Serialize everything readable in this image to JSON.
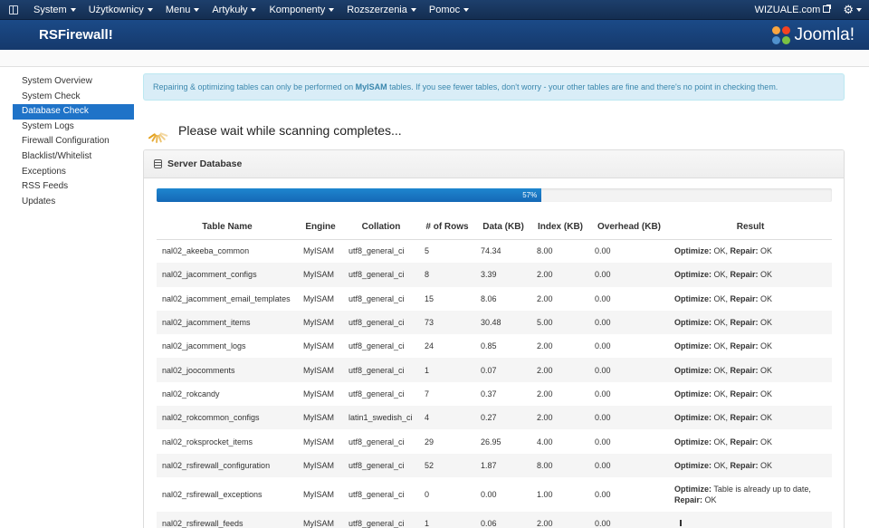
{
  "topbar": {
    "menu": [
      "System",
      "Użytkownicy",
      "Menu",
      "Artykuły",
      "Komponenty",
      "Rozszerzenia",
      "Pomoc"
    ],
    "site_link": "WIZUALE.com"
  },
  "header": {
    "title": "RSFirewall!",
    "brand": "Joomla!"
  },
  "sidebar": {
    "items": [
      "System Overview",
      "System Check",
      "Database Check",
      "System Logs",
      "Firewall Configuration",
      "Blacklist/Whitelist",
      "Exceptions",
      "RSS Feeds",
      "Updates"
    ],
    "active_index": 2
  },
  "alert": {
    "before": "Repairing & optimizing tables can only be performed on ",
    "highlight": "MyISAM",
    "after": " tables. If you see fewer tables, don't worry - your other tables are fine and there's no point in checking them."
  },
  "scan": {
    "message": "Please wait while scanning completes..."
  },
  "panel": {
    "title": "Server Database"
  },
  "progress": {
    "percent": 57,
    "label": "57%"
  },
  "table": {
    "columns": [
      "Table Name",
      "Engine",
      "Collation",
      "# of Rows",
      "Data (KB)",
      "Index (KB)",
      "Overhead (KB)",
      "Result"
    ],
    "labels": {
      "optimize": "Optimize:",
      "repair": "Repair:"
    },
    "rows": [
      {
        "name": "nal02_akeeba_common",
        "engine": "MyISAM",
        "collation": "utf8_general_ci",
        "rows": "5",
        "data": "74.34",
        "index": "8.00",
        "overhead": "0.00",
        "optimize": " OK, ",
        "repair": " OK"
      },
      {
        "name": "nal02_jacomment_configs",
        "engine": "MyISAM",
        "collation": "utf8_general_ci",
        "rows": "8",
        "data": "3.39",
        "index": "2.00",
        "overhead": "0.00",
        "optimize": " OK, ",
        "repair": " OK"
      },
      {
        "name": "nal02_jacomment_email_templates",
        "engine": "MyISAM",
        "collation": "utf8_general_ci",
        "rows": "15",
        "data": "8.06",
        "index": "2.00",
        "overhead": "0.00",
        "optimize": " OK, ",
        "repair": " OK"
      },
      {
        "name": "nal02_jacomment_items",
        "engine": "MyISAM",
        "collation": "utf8_general_ci",
        "rows": "73",
        "data": "30.48",
        "index": "5.00",
        "overhead": "0.00",
        "optimize": " OK, ",
        "repair": " OK"
      },
      {
        "name": "nal02_jacomment_logs",
        "engine": "MyISAM",
        "collation": "utf8_general_ci",
        "rows": "24",
        "data": "0.85",
        "index": "2.00",
        "overhead": "0.00",
        "optimize": " OK, ",
        "repair": " OK"
      },
      {
        "name": "nal02_joocomments",
        "engine": "MyISAM",
        "collation": "utf8_general_ci",
        "rows": "1",
        "data": "0.07",
        "index": "2.00",
        "overhead": "0.00",
        "optimize": " OK, ",
        "repair": " OK"
      },
      {
        "name": "nal02_rokcandy",
        "engine": "MyISAM",
        "collation": "utf8_general_ci",
        "rows": "7",
        "data": "0.37",
        "index": "2.00",
        "overhead": "0.00",
        "optimize": " OK, ",
        "repair": " OK"
      },
      {
        "name": "nal02_rokcommon_configs",
        "engine": "MyISAM",
        "collation": "latin1_swedish_ci",
        "rows": "4",
        "data": "0.27",
        "index": "2.00",
        "overhead": "0.00",
        "optimize": " OK, ",
        "repair": " OK"
      },
      {
        "name": "nal02_roksprocket_items",
        "engine": "MyISAM",
        "collation": "utf8_general_ci",
        "rows": "29",
        "data": "26.95",
        "index": "4.00",
        "overhead": "0.00",
        "optimize": " OK, ",
        "repair": " OK"
      },
      {
        "name": "nal02_rsfirewall_configuration",
        "engine": "MyISAM",
        "collation": "utf8_general_ci",
        "rows": "52",
        "data": "1.87",
        "index": "8.00",
        "overhead": "0.00",
        "optimize": " OK, ",
        "repair": " OK"
      },
      {
        "name": "nal02_rsfirewall_exceptions",
        "engine": "MyISAM",
        "collation": "utf8_general_ci",
        "rows": "0",
        "data": "0.00",
        "index": "1.00",
        "overhead": "0.00",
        "optimize": " Table is already up to date, ",
        "repair": " OK"
      },
      {
        "name": "nal02_rsfirewall_feeds",
        "engine": "MyISAM",
        "collation": "utf8_general_ci",
        "rows": "1",
        "data": "0.06",
        "index": "2.00",
        "overhead": "0.00",
        "optimize": "",
        "repair": ""
      }
    ]
  },
  "colors": {
    "accent": "#1f73c8",
    "header": "#1b4a87",
    "topbar": "#17365d",
    "alert_bg": "#d9edf7"
  }
}
